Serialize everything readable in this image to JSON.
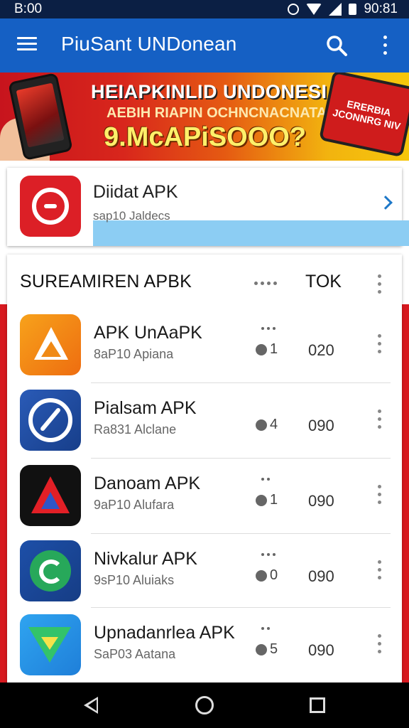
{
  "status_bar": {
    "time": "B:00",
    "right_text": "90:81"
  },
  "app_bar": {
    "title": "PiuSant UNDonean",
    "icons": [
      "menu-icon",
      "search-icon",
      "overflow-menu-icon"
    ]
  },
  "banner": {
    "line1": "HEIAPKINLID UNDONESIAI",
    "line2": "AEBIH RIAPIN OCHNCNACNATAN",
    "line3": "9.McAPiSOOO?",
    "tag_text": "ERERBIA JCONNRG NIV"
  },
  "featured": {
    "name": "Diidat APK",
    "subtitle": "sap10 Jaldecs",
    "icon": "app-icon-red-circle",
    "colors": {
      "icon_bg": "#dc1f26",
      "progress": "#8ccdf3",
      "chevron": "#1e78c8"
    }
  },
  "section": {
    "title": "SUREAMIREN APBK",
    "right_label": "TOK"
  },
  "apps": [
    {
      "name": "APK UnAaPK",
      "subtitle": "8aP10 Apiana",
      "rating": "1",
      "count": "020",
      "icon": "app-icon-orange-triangle"
    },
    {
      "name": "Pialsam APK",
      "subtitle": "Ra831 Alclane",
      "rating": "4",
      "count": "090",
      "icon": "app-icon-blue-compass"
    },
    {
      "name": "Danoam APK",
      "subtitle": "9aP10 Alufara",
      "rating": "1",
      "count": "090",
      "icon": "app-icon-red-delta"
    },
    {
      "name": "Nivkalur APK",
      "subtitle": "9sP10 Aluiaks",
      "rating": "0",
      "count": "090",
      "icon": "app-icon-green-circle"
    },
    {
      "name": "Upnadanrlea APK",
      "subtitle": "SaP03 Aatana",
      "rating": "5",
      "count": "090",
      "icon": "app-icon-green-gem"
    }
  ],
  "colors": {
    "status_bar": "#0b1f44",
    "app_bar": "#1560c4",
    "backdrop_red": "#d7191f"
  },
  "nav_bar": [
    "back-icon",
    "home-icon",
    "recents-icon"
  ]
}
